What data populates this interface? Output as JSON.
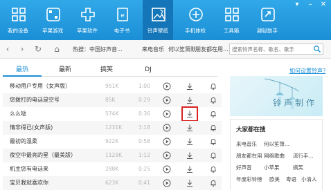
{
  "toolbar": {
    "items": [
      {
        "label": "我的设备",
        "icon": "device-icon"
      },
      {
        "label": "苹果游戏",
        "icon": "game-icon"
      },
      {
        "label": "苹果软件",
        "icon": "apps-icon"
      },
      {
        "label": "电子书",
        "icon": "ebook-icon"
      },
      {
        "label": "铃声壁纸",
        "icon": "ringtone-wallpaper-icon"
      },
      {
        "label": "手机体检",
        "icon": "checkup-icon"
      },
      {
        "label": "工具箱",
        "icon": "toolbox-icon"
      },
      {
        "label": "越狱助手",
        "icon": "jailbreak-icon"
      }
    ],
    "active_index": 4
  },
  "address_bar": {
    "hot_label": "热搜：中国好声音...",
    "hot_items": [
      "来电音乐",
      "何以笙箫默",
      "朋友都在用..."
    ],
    "search_placeholder": "搜索铃声名称、歌名、歌手"
  },
  "tabs": [
    "最热",
    "最新",
    "搞笑",
    "DJ"
  ],
  "active_tab": 0,
  "set_ringtone_link": "如何设置铃声?",
  "songs": [
    {
      "title": "移动用户专用（女声版）",
      "size": "951K",
      "duration": "1:00"
    },
    {
      "title": "您拨打的电话是空号",
      "size": "85K",
      "duration": "0:29"
    },
    {
      "title": "么么哒",
      "size": "574K",
      "duration": "0:36"
    },
    {
      "title": "情非得已(女声版)",
      "size": "1231K",
      "duration": "1:18"
    },
    {
      "title": "最初的温柔",
      "size": "922K",
      "duration": "0:58"
    },
    {
      "title": "夜空中最亮的星（最美版）",
      "size": "1129K",
      "duration": "1:12"
    },
    {
      "title": "机主您有电话来",
      "size": "288K",
      "duration": "0:25"
    },
    {
      "title": "宝贝我就喜欢你",
      "size": "623K",
      "duration": "0:41"
    }
  ],
  "highlighted_download_row": 2,
  "banner": {
    "text": "铃声制作"
  },
  "popular": {
    "title": "大家都在搜",
    "tags": [
      [
        "来电音乐",
        "何以笙箫..."
      ],
      [
        "朋友都在用",
        "网络歌曲",
        "流行手..."
      ],
      [
        "好声音",
        "小苹果",
        "搞笑"
      ],
      [
        "年度彩铃榜",
        "欧美",
        "粤语",
        "小清人"
      ]
    ]
  },
  "colors": {
    "accent": "#1b8fd6",
    "highlight": "#d92323"
  }
}
